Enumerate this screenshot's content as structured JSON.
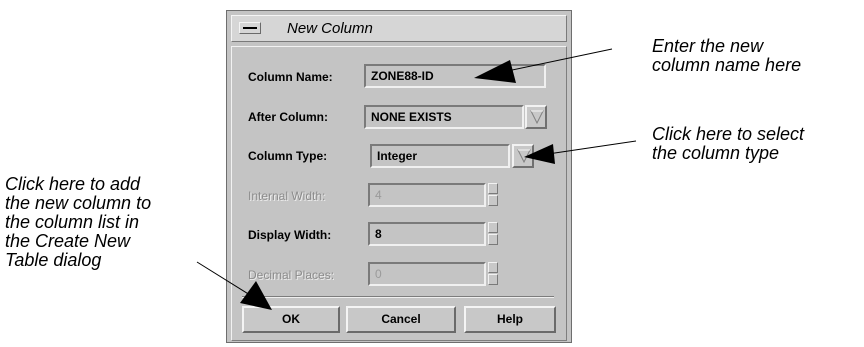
{
  "dialog": {
    "title": "New Column",
    "fields": {
      "column_name": {
        "label": "Column Name:",
        "value": "ZONE88-ID"
      },
      "after_column": {
        "label": "After Column:",
        "value": "NONE EXISTS"
      },
      "column_type": {
        "label": "Column Type:",
        "value": "Integer"
      },
      "internal_width": {
        "label": "Internal Width:",
        "value": "4"
      },
      "display_width": {
        "label": "Display Width:",
        "value": "8"
      },
      "decimal_places": {
        "label": "Decimal Places:",
        "value": "0"
      }
    },
    "buttons": {
      "ok": "OK",
      "cancel": "Cancel",
      "help": "Help"
    }
  },
  "annotations": {
    "column_name": [
      "Enter the new",
      "column name here"
    ],
    "column_type": [
      "Click here to select",
      "the column type"
    ],
    "ok": [
      "Click here to add",
      "the new column to",
      "the column list in",
      "the Create New",
      "Table dialog"
    ]
  }
}
